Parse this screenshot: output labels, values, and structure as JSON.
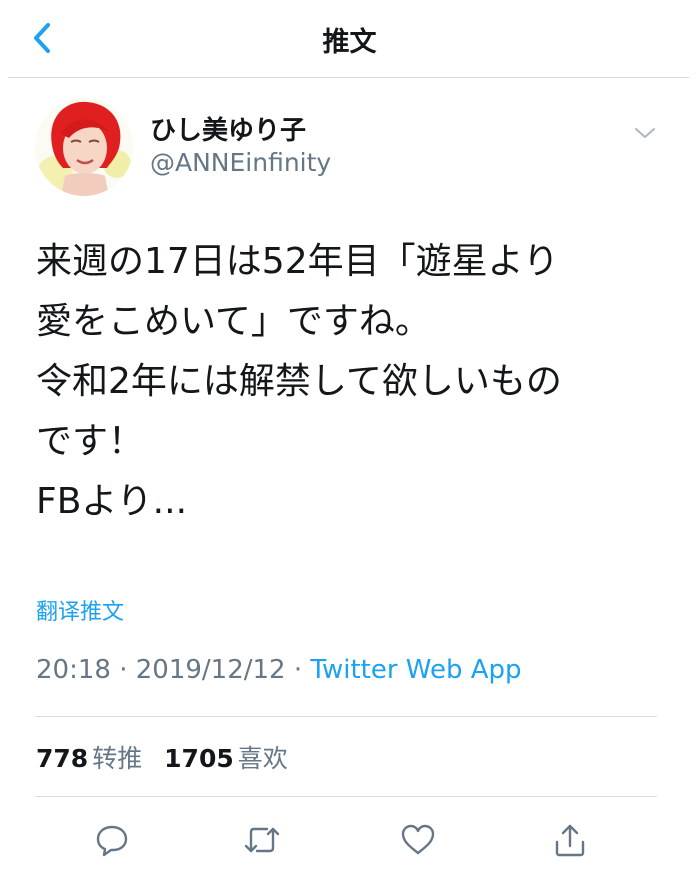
{
  "header": {
    "title": "推文",
    "back_icon": "chevron-left-icon"
  },
  "author": {
    "display_name": "ひし美ゆり子",
    "handle": "@ANNEinfinity"
  },
  "tweet": {
    "lines": [
      "来週の17日は52年目「遊星より",
      "愛をこめいて」ですね。",
      "令和2年には解禁して欲しいもの",
      "です！",
      "FBより..."
    ]
  },
  "translate_label": "翻译推文",
  "meta": {
    "time": "20:18",
    "separator": "·",
    "date": "2019/12/12",
    "source": "Twitter Web App"
  },
  "stats": {
    "retweets": "778",
    "retweets_label": "转推",
    "likes": "1705",
    "likes_label": "喜欢"
  },
  "actions": [
    "reply-icon",
    "retweet-icon",
    "like-icon",
    "share-icon"
  ],
  "colors": {
    "accent": "#1da1f2",
    "text": "#14171a",
    "secondary": "#657786",
    "divider": "#d6dbdf"
  }
}
